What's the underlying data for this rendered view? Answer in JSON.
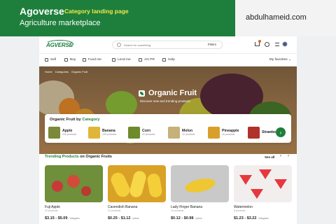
{
  "header": {
    "brand": "Agoverse",
    "category_page": "Category landing page",
    "subtitle": "Agriculture marketplace",
    "handle": "abdulhameid.com"
  },
  "navbar": {
    "logo": "AGVERSE",
    "search_placeholder": "Search for something",
    "filters_label": "Filters"
  },
  "subnav": {
    "items": [
      {
        "label": "Sell",
        "icon": "sell-icon"
      },
      {
        "label": "Buy",
        "icon": "buy-icon"
      },
      {
        "label": "Fund me",
        "icon": "fund-icon"
      },
      {
        "label": "Lend me",
        "icon": "lend-icon"
      },
      {
        "label": "AG PR",
        "icon": "pr-icon"
      },
      {
        "label": "Help",
        "icon": "help-icon"
      }
    ],
    "favorites": "My favorites ⌄"
  },
  "hero": {
    "breadcrumb": [
      "Home",
      "Categories",
      "Organic Fruit"
    ],
    "title": "Organic Fruit",
    "subtitle": "Discover new and trending products"
  },
  "categories": {
    "title_prefix": "Organic Fruit by",
    "title_accent": "Category",
    "items": [
      {
        "name": "Apple",
        "count": "216 products",
        "color": "#7a8a3a"
      },
      {
        "name": "Banana",
        "count": "125 products",
        "color": "#e0b63a"
      },
      {
        "name": "Corn",
        "count": "22 products",
        "color": "#6e8a2a"
      },
      {
        "name": "Melon",
        "count": "12 products",
        "color": "#c8b07a"
      },
      {
        "name": "Pineapple",
        "count": "16 products",
        "color": "#d8a02a"
      },
      {
        "name": "Strawberry",
        "count": "",
        "color": "#b0322a"
      }
    ],
    "next": "›"
  },
  "trending": {
    "title_prefix": "Trending Products",
    "title_suffix": "on Organic Fruits",
    "see_all": "See all",
    "prev": "‹",
    "next": "›",
    "products": [
      {
        "name": "Fuji Apple",
        "count": "12 products",
        "price": "$3.15 - $5.09",
        "unit": "/ kilogram"
      },
      {
        "name": "Cavendish Banana",
        "count": "21 products",
        "price": "$0.25 - $1.12",
        "unit": "/ piece"
      },
      {
        "name": "Lady Finger Banana",
        "count": "14 products",
        "price": "$0.12 - $0.98",
        "unit": "/ piece"
      },
      {
        "name": "Watermelon",
        "count": "8 products",
        "price": "$1.23 - $3.22",
        "unit": "/ kilogram"
      }
    ]
  },
  "colors": {
    "brand_green": "#1e7f3c",
    "accent_yellow": "#f2e84a"
  }
}
